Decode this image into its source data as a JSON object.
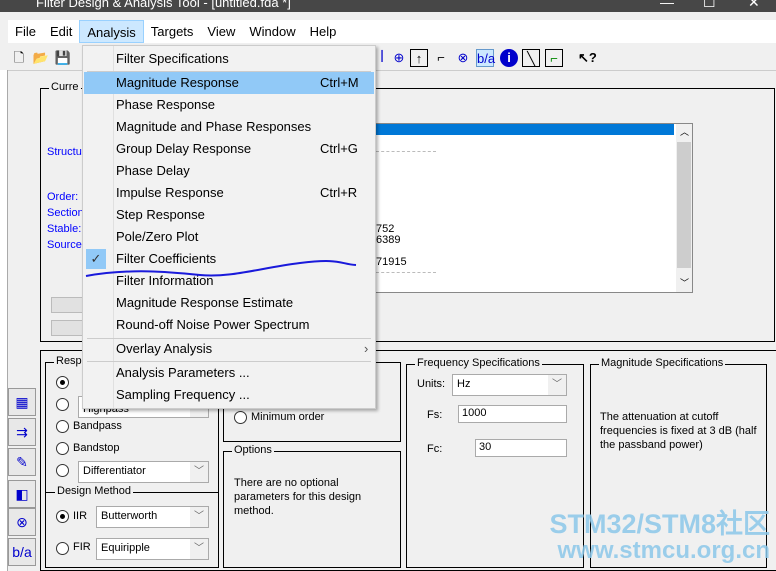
{
  "window": {
    "title": "Filter Design & Analysis Tool -  [untitled.fda *]"
  },
  "menubar": [
    "File",
    "Edit",
    "Analysis",
    "Targets",
    "View",
    "Window",
    "Help"
  ],
  "analysis_menu": {
    "items": [
      {
        "label": "Filter Specifications",
        "shortcut": ""
      },
      {
        "label": "Magnitude Response",
        "shortcut": "Ctrl+M",
        "highlighted": true
      },
      {
        "label": "Phase Response",
        "shortcut": ""
      },
      {
        "label": "Magnitude and Phase Responses",
        "shortcut": ""
      },
      {
        "label": "Group Delay Response",
        "shortcut": "Ctrl+G"
      },
      {
        "label": "Phase Delay",
        "shortcut": ""
      },
      {
        "label": "Impulse Response",
        "shortcut": "Ctrl+R"
      },
      {
        "label": "Step Response",
        "shortcut": ""
      },
      {
        "label": "Pole/Zero Plot",
        "shortcut": ""
      },
      {
        "label": "Filter Coefficients",
        "shortcut": "",
        "checked": true
      },
      {
        "label": "Filter Information",
        "shortcut": ""
      },
      {
        "label": "Magnitude Response Estimate",
        "shortcut": ""
      },
      {
        "label": "Round-off Noise Power Spectrum",
        "shortcut": ""
      }
    ],
    "overlay": "Overlay Analysis",
    "params": "Analysis Parameters ...",
    "sampling": "Sampling Frequency ..."
  },
  "current_filter": {
    "group_label": "Curre",
    "labels": [
      "Structu",
      "Order:",
      "Section",
      "Stable:",
      "Source"
    ],
    "list_fragments": [
      "752",
      "6389",
      "71915"
    ]
  },
  "response_type": {
    "label": "Resp",
    "options": [
      "Bandpass",
      "Bandstop"
    ],
    "combo2_fragment": "Highpass",
    "differentiator": "Differentiator"
  },
  "filter_order": {
    "minimum": "Minimum order"
  },
  "options": {
    "label": "Options",
    "text": "There are no optional parameters for this design method."
  },
  "design_method": {
    "label": "Design Method",
    "iir": "IIR",
    "iir_value": "Butterworth",
    "fir": "FIR",
    "fir_value": "Equiripple"
  },
  "frequency_specs": {
    "label": "Frequency Specifications",
    "units_label": "Units:",
    "units": "Hz",
    "fs_label": "Fs:",
    "fs": "1000",
    "fc_label": "Fc:",
    "fc": "30"
  },
  "magnitude_specs": {
    "label": "Magnitude Specifications",
    "text": "The attenuation at cutoff frequencies is fixed at 3 dB (half the passband power)"
  },
  "watermark": {
    "line1": "STM32/STM8社区",
    "line2": "www.stmcu.org.cn"
  },
  "colors": {
    "highlight": "#91c9f7",
    "selection": "#0078d7",
    "label_blue": "#0000ff",
    "annotation": "#1a1adb"
  }
}
